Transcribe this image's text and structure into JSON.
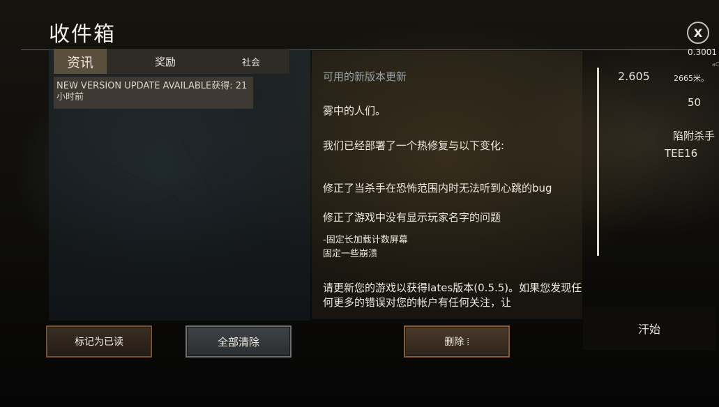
{
  "header": {
    "title": "收件箱"
  },
  "close_label": "X",
  "tabs": [
    {
      "label": "资讯",
      "active": true
    },
    {
      "label": "奖励",
      "active": false
    },
    {
      "label": "社会",
      "active": false
    }
  ],
  "inbox": {
    "items": [
      {
        "line1": "NEW VERSION UPDATE AVAILABLE获得: 21",
        "line2": "小时前"
      }
    ]
  },
  "message": {
    "subject": "可用的新版本更新",
    "greeting": "雾中的人们。",
    "intro": "我们已经部署了一个热修复与以下变化:",
    "fix1": "修正了当杀手在恐怖范围内时无法听到心跳的bug",
    "fix2": "修正了游戏中没有显示玩家名字的问题",
    "fix3": "-固定长加载计数屏幕",
    "fix4": "固定一些崩溃",
    "outro": "请更新您的游戏以获得lates版本(0.5.5)。如果您发现任何更多的错误对您的帐户有任何关注，让"
  },
  "side_stats": {
    "top_value": "0.3001",
    "small_tag": "aC",
    "value_a": "2.605",
    "value_b": "2665米。",
    "value_c": "50",
    "label_killer": "陷附杀手",
    "code": "TEE16",
    "start": "汗始"
  },
  "buttons": {
    "mark_read": "标记为已读",
    "clear_all": "全部清除",
    "delete": "删除 ⦙"
  },
  "colors": {
    "accent_border": "#8a6a45",
    "active_tab": "#5a4e3c"
  }
}
